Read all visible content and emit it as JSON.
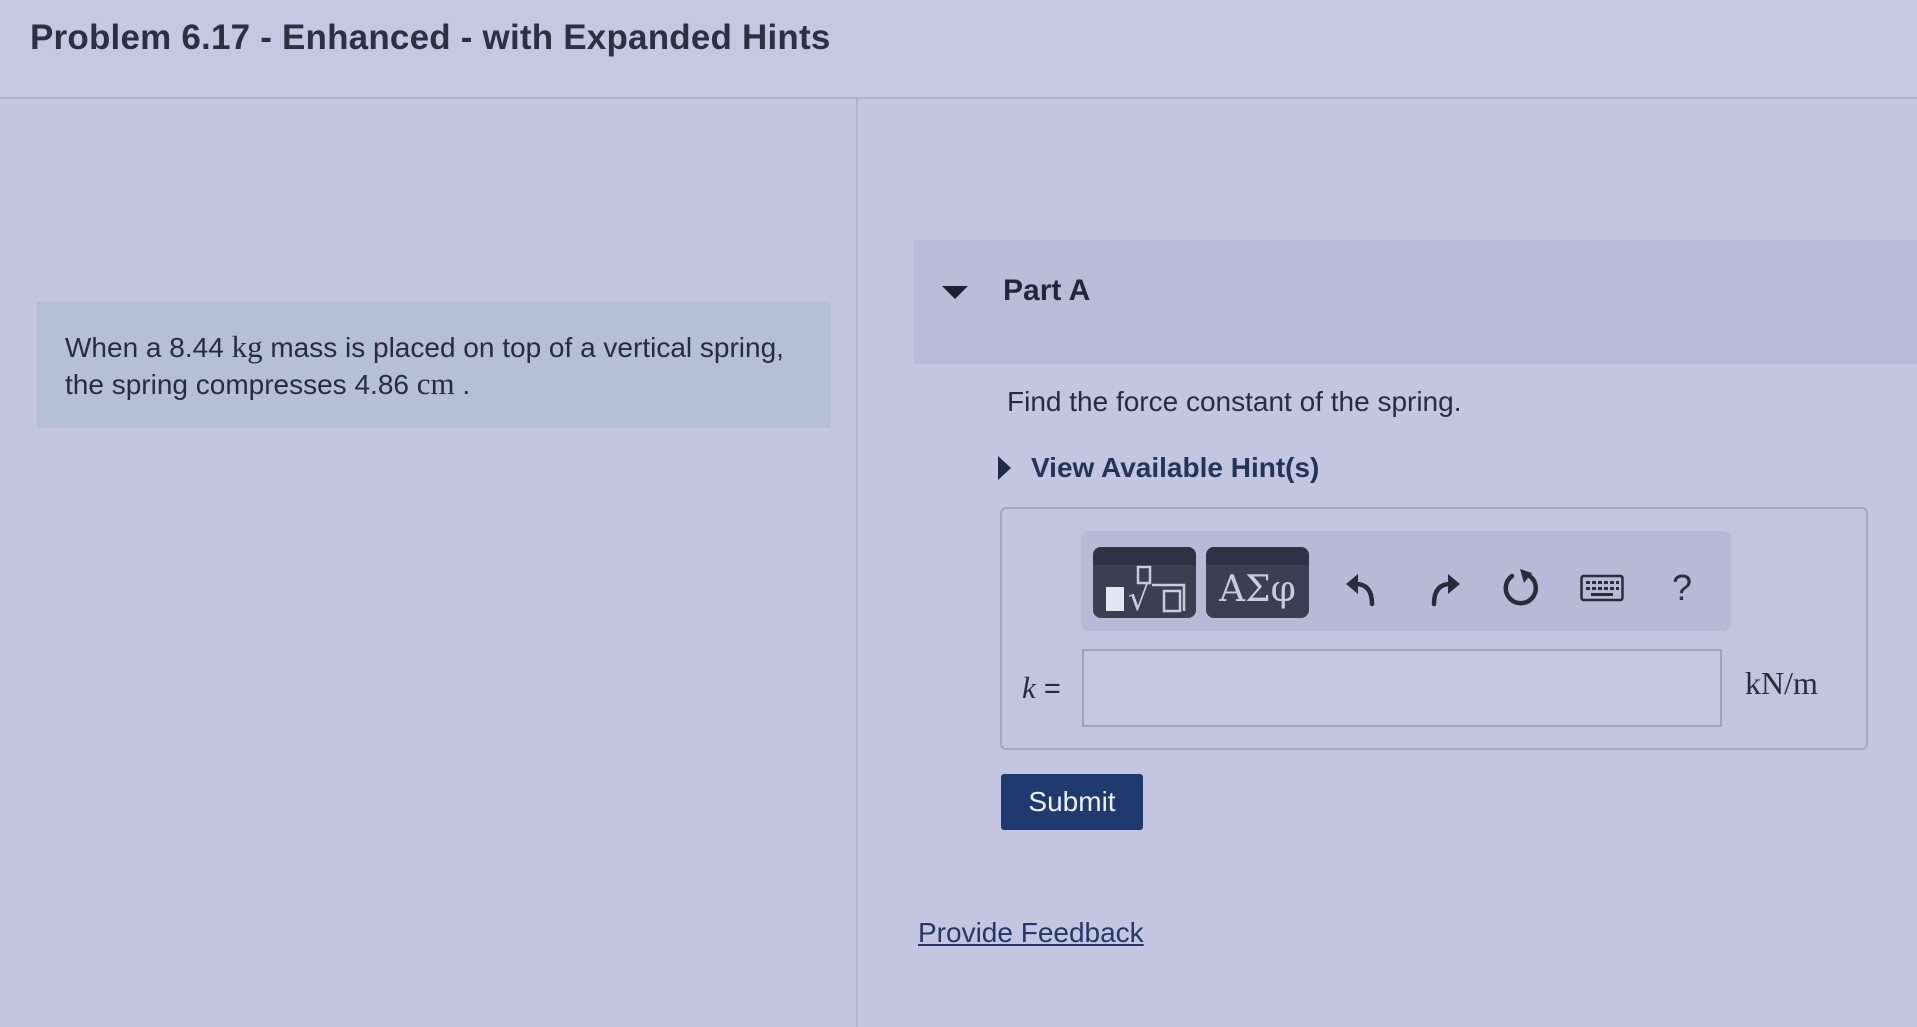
{
  "header": {
    "title": "Problem 6.17 - Enhanced - with Expanded Hints"
  },
  "problem": {
    "line1_pre": "When a 8.44 ",
    "line1_unit": "kg",
    "line1_post": " mass is placed on top of a vertical spring,",
    "line2_pre": "the spring compresses 4.86 ",
    "line2_unit": "cm",
    "line2_post": " ."
  },
  "part": {
    "title": "Part A",
    "question": "Find the force constant of the spring.",
    "hint_label": "View Available Hint(s)"
  },
  "toolbar": {
    "greek_label": "ΑΣφ",
    "help_label": "?"
  },
  "answer": {
    "variable": "k",
    "equals": " =",
    "value": "",
    "unit": "kN/m"
  },
  "actions": {
    "submit_label": "Submit",
    "feedback_label": "Provide Feedback"
  },
  "colors": {
    "background": "#c3c5e1",
    "submit_button": "#1e3a6e",
    "link": "#25376a"
  }
}
